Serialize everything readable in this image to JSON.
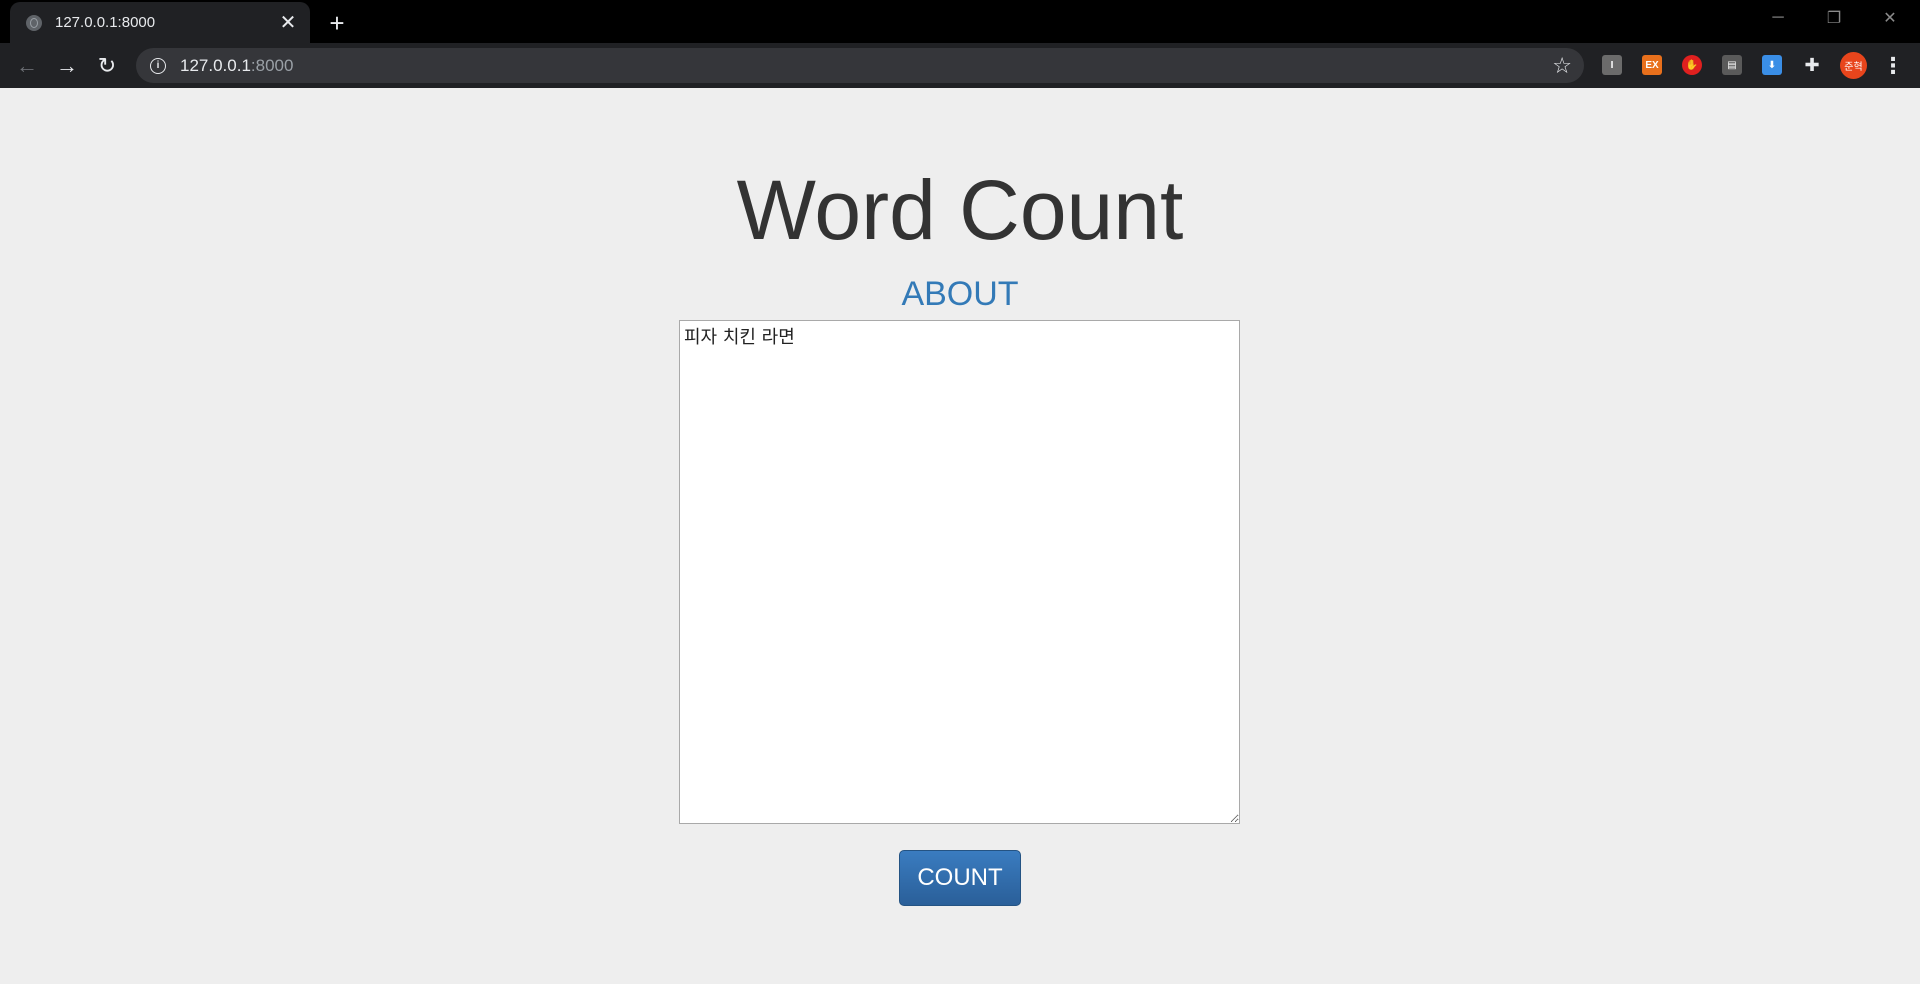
{
  "browser": {
    "tab_title": "127.0.0.1:8000",
    "url_host": "127.0.0.1",
    "url_port": ":8000",
    "profile_label": "준혁",
    "extensions": [
      {
        "name": "i-extension",
        "label": "I",
        "color": "#6b6b6b"
      },
      {
        "name": "ex-extension",
        "label": "EX",
        "color": "#e8701c"
      },
      {
        "name": "adblock-extension",
        "label": "✋",
        "color": "#e0201f"
      },
      {
        "name": "printer-extension",
        "label": "▤",
        "color": "#5a5a5a"
      },
      {
        "name": "download-extension",
        "label": "⬇",
        "color": "#3a8ee6"
      }
    ]
  },
  "page": {
    "title": "Word Count",
    "about_label": "ABOUT",
    "textarea_value": "피자 치킨 라면",
    "count_button_label": "COUNT"
  },
  "colors": {
    "page_background": "#eeeeee",
    "title_color": "#333333",
    "link_color": "#337ab7",
    "button_color": "#2f6da8"
  }
}
